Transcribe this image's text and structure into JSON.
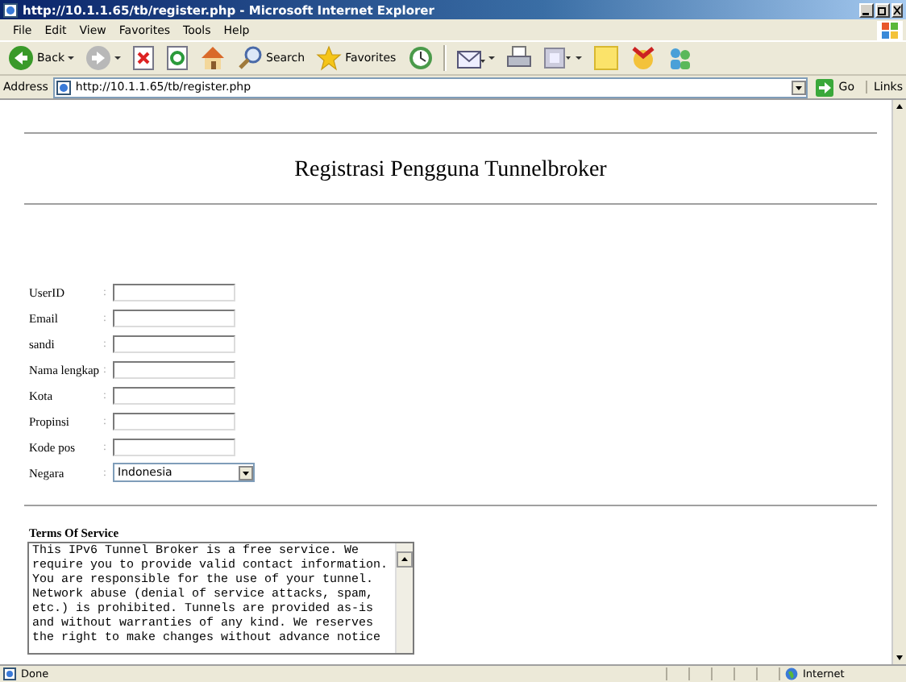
{
  "window": {
    "title": "http://10.1.1.65/tb/register.php - Microsoft Internet Explorer"
  },
  "menu": [
    "File",
    "Edit",
    "View",
    "Favorites",
    "Tools",
    "Help"
  ],
  "toolbar": [
    {
      "kind": "back",
      "label": "Back"
    },
    {
      "kind": "forward"
    },
    {
      "kind": "stop"
    },
    {
      "kind": "refresh"
    },
    {
      "kind": "home"
    },
    {
      "kind": "search",
      "label": "Search"
    },
    {
      "kind": "favorites",
      "label": "Favorites"
    },
    {
      "kind": "history"
    },
    {
      "kind": "mail"
    },
    {
      "kind": "print"
    },
    {
      "kind": "window"
    },
    {
      "kind": "note"
    },
    {
      "kind": "messenger"
    },
    {
      "kind": "people"
    }
  ],
  "address": {
    "label": "Address",
    "value": "http://10.1.1.65/tb/register.php",
    "go": "Go",
    "links": "Links"
  },
  "page": {
    "heading": "Registrasi Pengguna Tunnelbroker",
    "fields": [
      {
        "label": "UserID",
        "colon": ":",
        "kind": "text"
      },
      {
        "label": "Email",
        "colon": ":",
        "kind": "text"
      },
      {
        "label": "sandi",
        "colon": ":",
        "kind": "text"
      },
      {
        "label": "Nama lengkap",
        "colon": ":",
        "kind": "text"
      },
      {
        "label": "Kota",
        "colon": ":",
        "kind": "text"
      },
      {
        "label": "Propinsi",
        "colon": ":",
        "kind": "text"
      },
      {
        "label": "Kode pos",
        "colon": ":",
        "kind": "text"
      },
      {
        "label": "Negara",
        "colon": ":",
        "kind": "select",
        "value": "Indonesia"
      }
    ],
    "terms": {
      "heading": "Terms Of Service",
      "lines": [
        "This IPv6 Tunnel Broker is a free service. We",
        "require you to provide valid contact information.",
        "You are responsible for the use of your tunnel.",
        "Network abuse (denial of service attacks, spam,",
        "etc.) is prohibited. Tunnels are provided as-is",
        "and without warranties of any kind. We reserves",
        "the right to make changes without advance notice"
      ]
    }
  },
  "status_bar": {
    "text": "Done",
    "zone": "Internet"
  }
}
